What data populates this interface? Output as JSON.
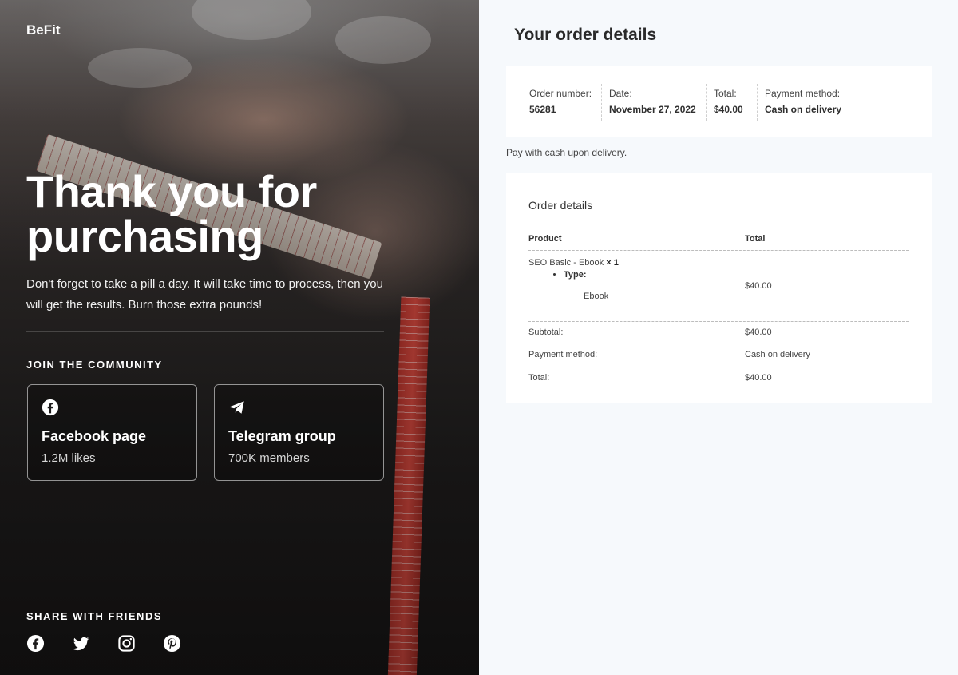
{
  "left": {
    "brand": "BeFit",
    "hero_title": "Thank you for purchasing",
    "hero_subtitle": "Don't forget to take a pill a day. It will take time to process, then you will get the results. Burn those extra pounds!",
    "community_heading": "JOIN THE COMMUNITY",
    "cards": [
      {
        "icon": "facebook-icon",
        "title": "Facebook page",
        "stat": "1.2M likes"
      },
      {
        "icon": "telegram-icon",
        "title": "Telegram group",
        "stat": "700K members"
      }
    ],
    "share_heading": "SHARE WITH FRIENDS",
    "share_icons": [
      "facebook-icon",
      "twitter-icon",
      "instagram-icon",
      "pinterest-icon"
    ]
  },
  "order": {
    "title": "Your order details",
    "summary": [
      {
        "label": "Order number:",
        "value": "56281"
      },
      {
        "label": "Date:",
        "value": "November 27, 2022"
      },
      {
        "label": "Total:",
        "value": "$40.00"
      },
      {
        "label": "Payment method:",
        "value": "Cash on delivery"
      }
    ],
    "payment_note": "Pay with cash upon delivery.",
    "details": {
      "heading": "Order details",
      "col_product": "Product",
      "col_total": "Total",
      "item": {
        "name": "SEO Basic - Ebook",
        "qty": "× 1",
        "meta_label": "Type:",
        "meta_value": "Ebook",
        "total": "$40.00"
      },
      "rows": [
        {
          "label": "Subtotal:",
          "value": "$40.00"
        },
        {
          "label": "Payment method:",
          "value": "Cash on delivery"
        },
        {
          "label": "Total:",
          "value": "$40.00"
        }
      ]
    }
  },
  "colors": {
    "left_bg": "#1f1d1d",
    "right_bg": "#f6f9fc",
    "tape_red": "#c0392b"
  }
}
